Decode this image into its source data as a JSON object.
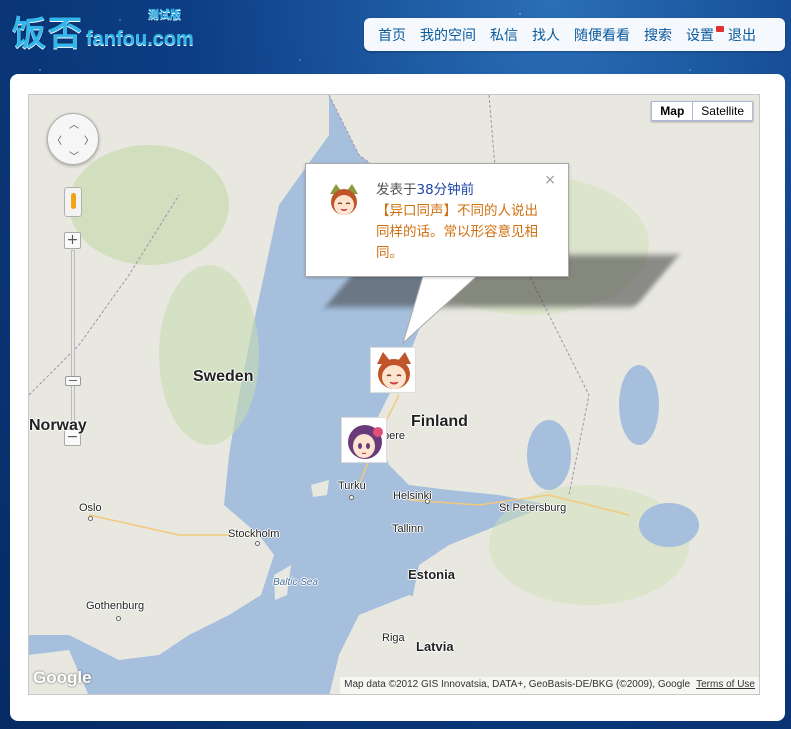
{
  "header": {
    "logo_cn": "饭否",
    "logo_en": "fanfou.com",
    "logo_beta": "测试版"
  },
  "nav": {
    "items": [
      "首页",
      "我的空间",
      "私信",
      "找人",
      "随便看看",
      "搜索",
      "设置",
      "退出"
    ]
  },
  "map": {
    "type_buttons": {
      "map": "Map",
      "satellite": "Satellite"
    },
    "countries": {
      "sweden": "Sweden",
      "norway": "Norway",
      "finland": "Finland",
      "estonia": "Estonia",
      "latvia": "Latvia"
    },
    "cities": {
      "oslo": "Oslo",
      "stockholm": "Stockholm",
      "gothenburg": "Gothenburg",
      "turku": "Turku",
      "helsinki": "Helsinki",
      "tallinn": "Tallinn",
      "st_petersburg": "St Petersburg",
      "riga": "Riga",
      "tampere": "pere"
    },
    "sea": "Baltic Sea",
    "logo": "Google",
    "attribution": "Map data ©2012 GIS Innovatsia, DATA+, GeoBasis-DE/BKG (©2009), Google",
    "terms": "Terms of Use",
    "zoom_in": "+",
    "zoom_out": "−"
  },
  "bubble": {
    "prefix": "发表于",
    "time": "38分钟前",
    "message": "【异口同声】不同的人说出同样的话。常以形容意见相同。",
    "close": "×"
  },
  "colors": {
    "brand": "#33b6ea",
    "nav_text": "#0a5a9c",
    "message": "#d07010",
    "water": "#a5bfdd",
    "land": "#e8e8e0"
  }
}
